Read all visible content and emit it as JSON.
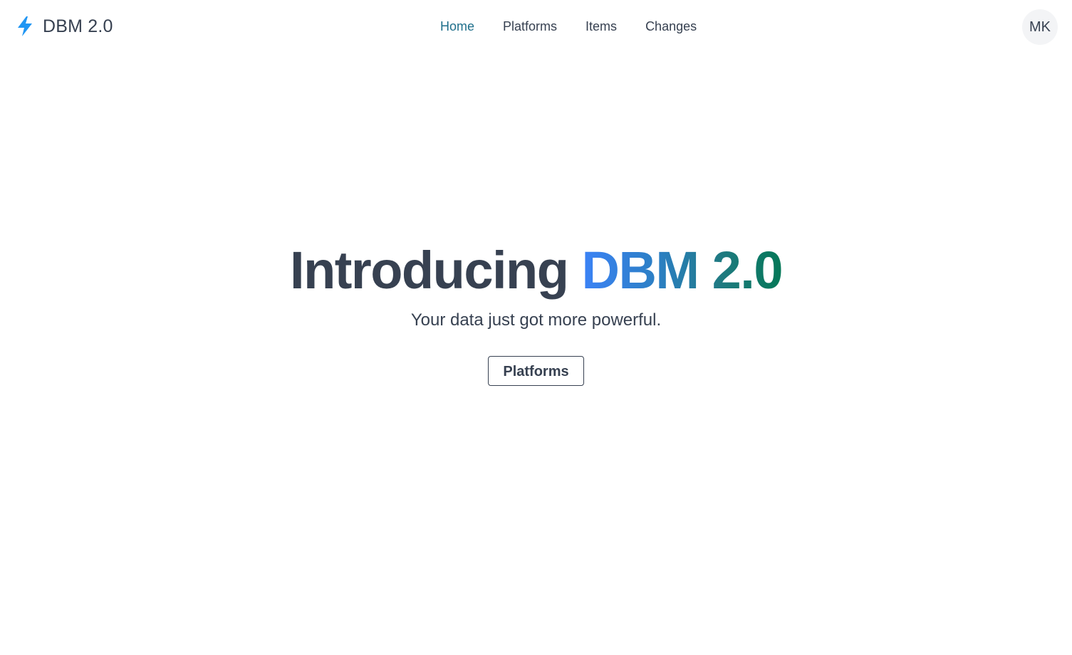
{
  "header": {
    "brand": {
      "icon": "lightning-bolt-icon",
      "name": "DBM 2.0",
      "icon_color": "#2196f3"
    },
    "nav": [
      {
        "label": "Home",
        "active": true
      },
      {
        "label": "Platforms",
        "active": false
      },
      {
        "label": "Items",
        "active": false
      },
      {
        "label": "Changes",
        "active": false
      }
    ],
    "user_initials": "MK"
  },
  "hero": {
    "title_prefix": "Introducing",
    "title_accent": "DBM 2.0",
    "subtitle": "Your data just got more powerful.",
    "cta_label": "Platforms"
  },
  "colors": {
    "text": "#374151",
    "nav_active": "#1f6f8b",
    "gradient_start": "#3b82f6",
    "gradient_end": "#047857",
    "avatar_bg": "#f3f4f6"
  }
}
